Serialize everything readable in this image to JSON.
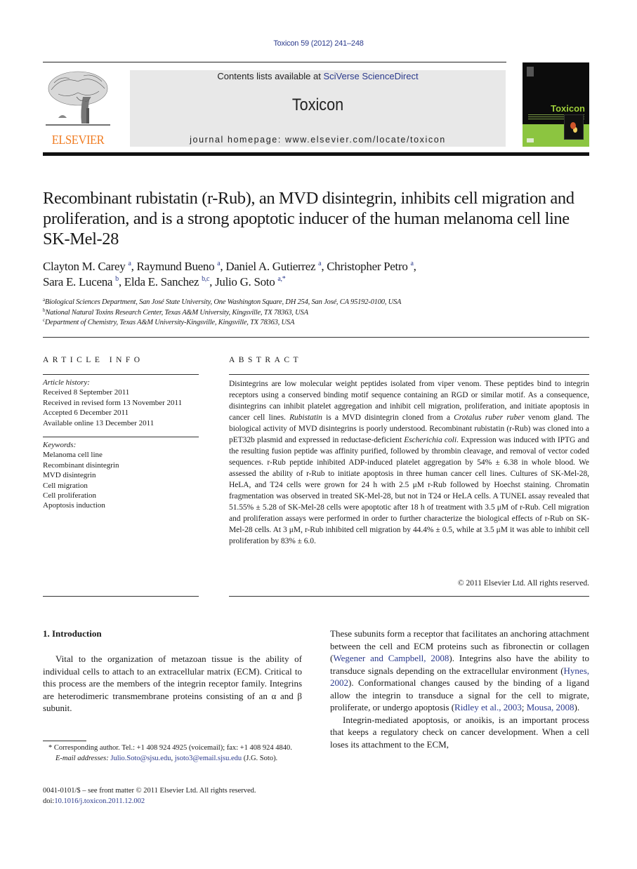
{
  "header": {
    "citation": "Toxicon 59 (2012) 241–248",
    "contents_prefix": "Contents lists available at ",
    "contents_link": "SciVerse ScienceDirect",
    "journal_name": "Toxicon",
    "homepage_prefix": "journal homepage: ",
    "homepage_url": "www.elsevier.com/locate/toxicon",
    "publisher_logo_text": "ELSEVIER",
    "cover_title": "Toxicon",
    "colors": {
      "publisher_orange": "#f07c22",
      "link_blue": "#2b3a8c",
      "cover_green": "#8cc540"
    }
  },
  "article": {
    "title": "Recombinant rubistatin (r-Rub), an MVD disintegrin, inhibits cell migration and proliferation, and is a strong apoptotic inducer of the human melanoma cell line SK-Mel-28",
    "authors": [
      {
        "name": "Clayton M. Carey",
        "sup": "a",
        "sep": ", "
      },
      {
        "name": "Raymund Bueno",
        "sup": "a",
        "sep": ", "
      },
      {
        "name": "Daniel A. Gutierrez",
        "sup": "a",
        "sep": ", "
      },
      {
        "name": "Christopher Petro",
        "sup": "a",
        "sep": ","
      },
      {
        "name": "Sara E. Lucena",
        "sup": "b",
        "sep": ", "
      },
      {
        "name": "Elda E. Sanchez",
        "sup": "b,c",
        "sep": ", "
      },
      {
        "name": "Julio G. Soto",
        "sup": "a,*",
        "sep": ""
      }
    ],
    "affiliations": [
      {
        "key": "a",
        "text": "Biological Sciences Department, San José State University, One Washington Square, DH 254, San José, CA 95192-0100, USA"
      },
      {
        "key": "b",
        "text": "National Natural Toxins Research Center, Texas A&M University, Kingsville, TX 78363, USA"
      },
      {
        "key": "c",
        "text": "Department of Chemistry, Texas A&M University-Kingsville, Kingsville, TX 78363, USA"
      }
    ]
  },
  "article_info": {
    "heading": "ARTICLE INFO",
    "history_label": "Article history:",
    "history": [
      "Received 8 September 2011",
      "Received in revised form 13 November 2011",
      "Accepted 6 December 2011",
      "Available online 13 December 2011"
    ],
    "keywords_label": "Keywords:",
    "keywords": [
      "Melanoma cell line",
      "Recombinant disintegrin",
      "MVD disintegrin",
      "Cell migration",
      "Cell proliferation",
      "Apoptosis induction"
    ]
  },
  "abstract": {
    "heading": "ABSTRACT",
    "segments": [
      {
        "t": "Disintegrins are low molecular weight peptides isolated from viper venom. These peptides bind to integrin receptors using a conserved binding motif sequence containing an RGD or similar motif. As a consequence, disintegrins can inhibit platelet aggregation and inhibit cell migration, proliferation, and initiate apoptosis in cancer cell lines. "
      },
      {
        "t": "Rubistatin",
        "i": true
      },
      {
        "t": " is a MVD disintegrin cloned from a "
      },
      {
        "t": "Crotalus ruber ruber",
        "i": true
      },
      {
        "t": " venom gland. The biological activity of MVD disintegrins is poorly understood. Recombinant rubistatin (r-Rub) was cloned into a pET32b plasmid and expressed in reductase-deficient "
      },
      {
        "t": "Escherichia coli",
        "i": true
      },
      {
        "t": ". Expression was induced with IPTG and the resulting fusion peptide was affinity purified, followed by thrombin cleavage, and removal of vector coded sequences. r-Rub peptide inhibited ADP-induced platelet aggregation by 54% ± 6.38 in whole blood. We assessed the ability of r-Rub to initiate apoptosis in three human cancer cell lines. Cultures of SK-Mel-28, HeLA, and T24 cells were grown for 24 h with 2.5 μM r-Rub followed by Hoechst staining. Chromatin fragmentation was observed in treated SK-Mel-28, but not in T24 or HeLA cells. A TUNEL assay revealed that 51.55% ± 5.28 of SK-Mel-28 cells were apoptotic after 18 h of treatment with 3.5 μM of r-Rub. Cell migration and proliferation assays were performed in order to further characterize the biological effects of r-Rub on SK-Mel-28 cells. At 3 μM, r-Rub inhibited cell migration by 44.4% ± 0.5, while at 3.5 μM it was able to inhibit cell proliferation by 83% ± 6.0."
      }
    ],
    "copyright": "© 2011 Elsevier Ltd. All rights reserved."
  },
  "introduction": {
    "heading": "1.  Introduction",
    "left_paragraph": "Vital to the organization of metazoan tissue is the ability of individual cells to attach to an extracellular matrix (ECM). Critical to this process are the members of the integrin receptor family. Integrins are heterodimeric transmembrane proteins consisting of an α and β subunit.",
    "right_p1": [
      {
        "t": "These subunits form a receptor that facilitates an anchoring attachment between the cell and ECM proteins such as fibronectin or collagen ("
      },
      {
        "t": "Wegener and Campbell, 2008",
        "link": true
      },
      {
        "t": "). Integrins also have the ability to transduce signals depending on the extracellular environment ("
      },
      {
        "t": "Hynes, 2002",
        "link": true
      },
      {
        "t": "). Conformational changes caused by the binding of a ligand allow the integrin to transduce a signal for the cell to migrate, proliferate, or undergo apoptosis ("
      },
      {
        "t": "Ridley et al., 2003",
        "link": true
      },
      {
        "t": "; "
      },
      {
        "t": "Mousa, 2008",
        "link": true
      },
      {
        "t": ")."
      }
    ],
    "right_p2": "Integrin-mediated apoptosis, or anoikis, is an important process that keeps a regulatory check on cancer development. When a cell loses its attachment to the ECM,"
  },
  "footnotes": {
    "corresponding": "* Corresponding author. Tel.: +1 408 924 4925 (voicemail); fax: +1 408 924 4840.",
    "email_label": "E-mail addresses: ",
    "emails": [
      "Julio.Soto@sjsu.edu",
      "jsoto3@email.sjsu.edu"
    ],
    "email_suffix": " (J.G. Soto).",
    "front_matter": "0041-0101/$ – see front matter © 2011 Elsevier Ltd. All rights reserved.",
    "doi_prefix": "doi:",
    "doi": "10.1016/j.toxicon.2011.12.002"
  }
}
